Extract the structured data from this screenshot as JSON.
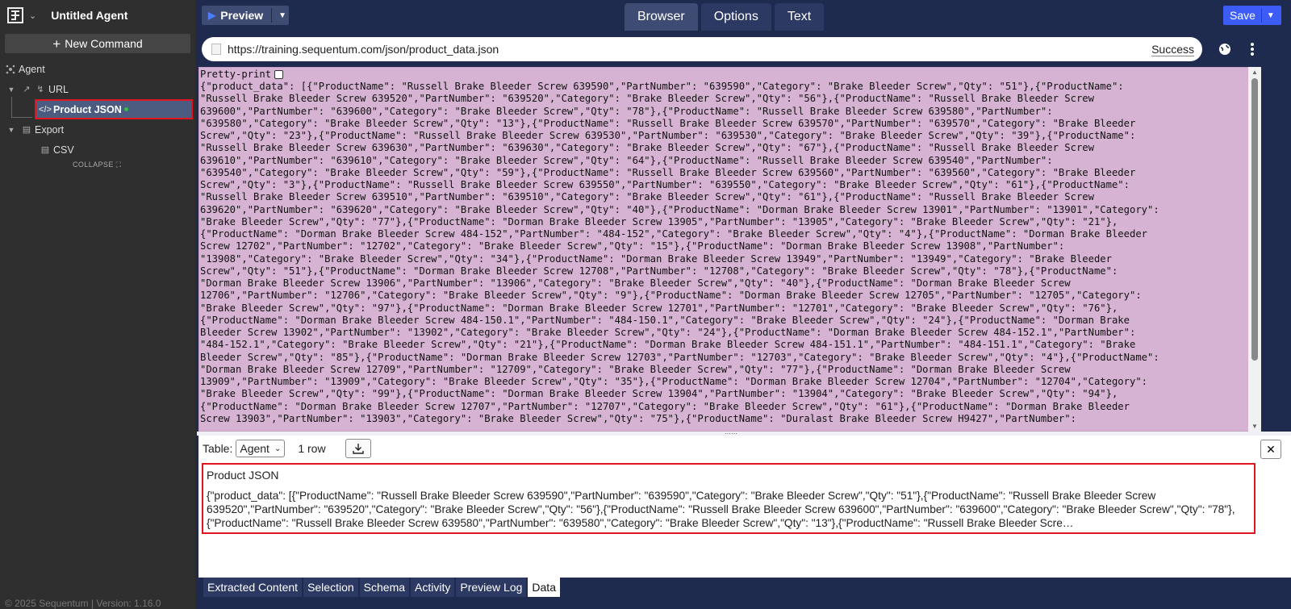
{
  "sidebar": {
    "agent_title": "Untitled Agent",
    "new_command": "New Command",
    "tree": {
      "agent": "Agent",
      "url": "URL",
      "product_json": "Product JSON",
      "export": "Export",
      "csv": "CSV"
    },
    "collapse": "COLLAPSE",
    "footer": "© 2025 Sequentum | Version: 1.16.0"
  },
  "toolbar": {
    "preview": "Preview",
    "save": "Save",
    "tabs": [
      "Browser",
      "Options",
      "Text"
    ],
    "active_tab": "Browser"
  },
  "browser": {
    "url": "https://training.sequentum.com/json/product_data.json",
    "status": "Success",
    "pretty_print_label": "Pretty-print",
    "json_lines": [
      "{\"product_data\": [{\"ProductName\": \"Russell Brake Bleeder Screw 639590\",\"PartNumber\": \"639590\",\"Category\": \"Brake Bleeder Screw\",\"Qty\": \"51\"},{\"ProductName\":",
      "\"Russell Brake Bleeder Screw 639520\",\"PartNumber\": \"639520\",\"Category\": \"Brake Bleeder Screw\",\"Qty\": \"56\"},{\"ProductName\": \"Russell Brake Bleeder Screw",
      "639600\",\"PartNumber\": \"639600\",\"Category\": \"Brake Bleeder Screw\",\"Qty\": \"78\"},{\"ProductName\": \"Russell Brake Bleeder Screw 639580\",\"PartNumber\":",
      "\"639580\",\"Category\": \"Brake Bleeder Screw\",\"Qty\": \"13\"},{\"ProductName\": \"Russell Brake Bleeder Screw 639570\",\"PartNumber\": \"639570\",\"Category\": \"Brake Bleeder",
      "Screw\",\"Qty\": \"23\"},{\"ProductName\": \"Russell Brake Bleeder Screw 639530\",\"PartNumber\": \"639530\",\"Category\": \"Brake Bleeder Screw\",\"Qty\": \"39\"},{\"ProductName\":",
      "\"Russell Brake Bleeder Screw 639630\",\"PartNumber\": \"639630\",\"Category\": \"Brake Bleeder Screw\",\"Qty\": \"67\"},{\"ProductName\": \"Russell Brake Bleeder Screw",
      "639610\",\"PartNumber\": \"639610\",\"Category\": \"Brake Bleeder Screw\",\"Qty\": \"64\"},{\"ProductName\": \"Russell Brake Bleeder Screw 639540\",\"PartNumber\":",
      "\"639540\",\"Category\": \"Brake Bleeder Screw\",\"Qty\": \"59\"},{\"ProductName\": \"Russell Brake Bleeder Screw 639560\",\"PartNumber\": \"639560\",\"Category\": \"Brake Bleeder",
      "Screw\",\"Qty\": \"3\"},{\"ProductName\": \"Russell Brake Bleeder Screw 639550\",\"PartNumber\": \"639550\",\"Category\": \"Brake Bleeder Screw\",\"Qty\": \"61\"},{\"ProductName\":",
      "\"Russell Brake Bleeder Screw 639510\",\"PartNumber\": \"639510\",\"Category\": \"Brake Bleeder Screw\",\"Qty\": \"61\"},{\"ProductName\": \"Russell Brake Bleeder Screw",
      "639620\",\"PartNumber\": \"639620\",\"Category\": \"Brake Bleeder Screw\",\"Qty\": \"40\"},{\"ProductName\": \"Dorman Brake Bleeder Screw 13901\",\"PartNumber\": \"13901\",\"Category\":",
      "\"Brake Bleeder Screw\",\"Qty\": \"77\"},{\"ProductName\": \"Dorman Brake Bleeder Screw 13905\",\"PartNumber\": \"13905\",\"Category\": \"Brake Bleeder Screw\",\"Qty\": \"21\"},",
      "{\"ProductName\": \"Dorman Brake Bleeder Screw 484-152\",\"PartNumber\": \"484-152\",\"Category\": \"Brake Bleeder Screw\",\"Qty\": \"4\"},{\"ProductName\": \"Dorman Brake Bleeder",
      "Screw 12702\",\"PartNumber\": \"12702\",\"Category\": \"Brake Bleeder Screw\",\"Qty\": \"15\"},{\"ProductName\": \"Dorman Brake Bleeder Screw 13908\",\"PartNumber\":",
      "\"13908\",\"Category\": \"Brake Bleeder Screw\",\"Qty\": \"34\"},{\"ProductName\": \"Dorman Brake Bleeder Screw 13949\",\"PartNumber\": \"13949\",\"Category\": \"Brake Bleeder",
      "Screw\",\"Qty\": \"51\"},{\"ProductName\": \"Dorman Brake Bleeder Screw 12708\",\"PartNumber\": \"12708\",\"Category\": \"Brake Bleeder Screw\",\"Qty\": \"78\"},{\"ProductName\":",
      "\"Dorman Brake Bleeder Screw 13906\",\"PartNumber\": \"13906\",\"Category\": \"Brake Bleeder Screw\",\"Qty\": \"40\"},{\"ProductName\": \"Dorman Brake Bleeder Screw",
      "12706\",\"PartNumber\": \"12706\",\"Category\": \"Brake Bleeder Screw\",\"Qty\": \"9\"},{\"ProductName\": \"Dorman Brake Bleeder Screw 12705\",\"PartNumber\": \"12705\",\"Category\":",
      "\"Brake Bleeder Screw\",\"Qty\": \"97\"},{\"ProductName\": \"Dorman Brake Bleeder Screw 12701\",\"PartNumber\": \"12701\",\"Category\": \"Brake Bleeder Screw\",\"Qty\": \"76\"},",
      "{\"ProductName\": \"Dorman Brake Bleeder Screw 484-150.1\",\"PartNumber\": \"484-150.1\",\"Category\": \"Brake Bleeder Screw\",\"Qty\": \"24\"},{\"ProductName\": \"Dorman Brake",
      "Bleeder Screw 13902\",\"PartNumber\": \"13902\",\"Category\": \"Brake Bleeder Screw\",\"Qty\": \"24\"},{\"ProductName\": \"Dorman Brake Bleeder Screw 484-152.1\",\"PartNumber\":",
      "\"484-152.1\",\"Category\": \"Brake Bleeder Screw\",\"Qty\": \"21\"},{\"ProductName\": \"Dorman Brake Bleeder Screw 484-151.1\",\"PartNumber\": \"484-151.1\",\"Category\": \"Brake",
      "Bleeder Screw\",\"Qty\": \"85\"},{\"ProductName\": \"Dorman Brake Bleeder Screw 12703\",\"PartNumber\": \"12703\",\"Category\": \"Brake Bleeder Screw\",\"Qty\": \"4\"},{\"ProductName\":",
      "\"Dorman Brake Bleeder Screw 12709\",\"PartNumber\": \"12709\",\"Category\": \"Brake Bleeder Screw\",\"Qty\": \"77\"},{\"ProductName\": \"Dorman Brake Bleeder Screw",
      "13909\",\"PartNumber\": \"13909\",\"Category\": \"Brake Bleeder Screw\",\"Qty\": \"35\"},{\"ProductName\": \"Dorman Brake Bleeder Screw 12704\",\"PartNumber\": \"12704\",\"Category\":",
      "\"Brake Bleeder Screw\",\"Qty\": \"99\"},{\"ProductName\": \"Dorman Brake Bleeder Screw 13904\",\"PartNumber\": \"13904\",\"Category\": \"Brake Bleeder Screw\",\"Qty\": \"94\"},",
      "{\"ProductName\": \"Dorman Brake Bleeder Screw 12707\",\"PartNumber\": \"12707\",\"Category\": \"Brake Bleeder Screw\",\"Qty\": \"61\"},{\"ProductName\": \"Dorman Brake Bleeder",
      "Screw 13903\",\"PartNumber\": \"13903\",\"Category\": \"Brake Bleeder Screw\",\"Qty\": \"75\"},{\"ProductName\": \"Duralast Brake Bleeder Screw H9427\",\"PartNumber\":"
    ]
  },
  "data_panel": {
    "table_label": "Table:",
    "table_select": "Agent",
    "row_count": "1 row",
    "column": "Product JSON",
    "cell": "{\"product_data\": [{\"ProductName\": \"Russell Brake Bleeder Screw 639590\",\"PartNumber\": \"639590\",\"Category\": \"Brake Bleeder Screw\",\"Qty\": \"51\"},{\"ProductName\": \"Russell Brake Bleeder Screw 639520\",\"PartNumber\": \"639520\",\"Category\": \"Brake Bleeder Screw\",\"Qty\": \"56\"},{\"ProductName\": \"Russell Brake Bleeder Screw 639600\",\"PartNumber\": \"639600\",\"Category\": \"Brake Bleeder Screw\",\"Qty\": \"78\"},{\"ProductName\": \"Russell Brake Bleeder Screw 639580\",\"PartNumber\": \"639580\",\"Category\": \"Brake Bleeder Screw\",\"Qty\": \"13\"},{\"ProductName\": \"Russell Brake Bleeder Scre…"
  },
  "bottom_tabs": [
    "Extracted Content",
    "Selection",
    "Schema",
    "Activity",
    "Preview Log",
    "Data"
  ],
  "active_bottom_tab": "Data",
  "colors": {
    "accent": "#3d5cf5",
    "selection_outline": "#e0151f",
    "json_background": "#d6b3d2",
    "main_background": "#1f2a4f",
    "sidebar_background": "#2f2f2f"
  },
  "icons": [
    "app-logo-icon",
    "chevron-down-icon",
    "plus-icon",
    "agent-icon",
    "url-icon",
    "code-icon",
    "export-icon",
    "csv-icon",
    "play-icon",
    "globe-icon",
    "more-vert-icon",
    "download-icon",
    "close-icon",
    "page-icon"
  ]
}
